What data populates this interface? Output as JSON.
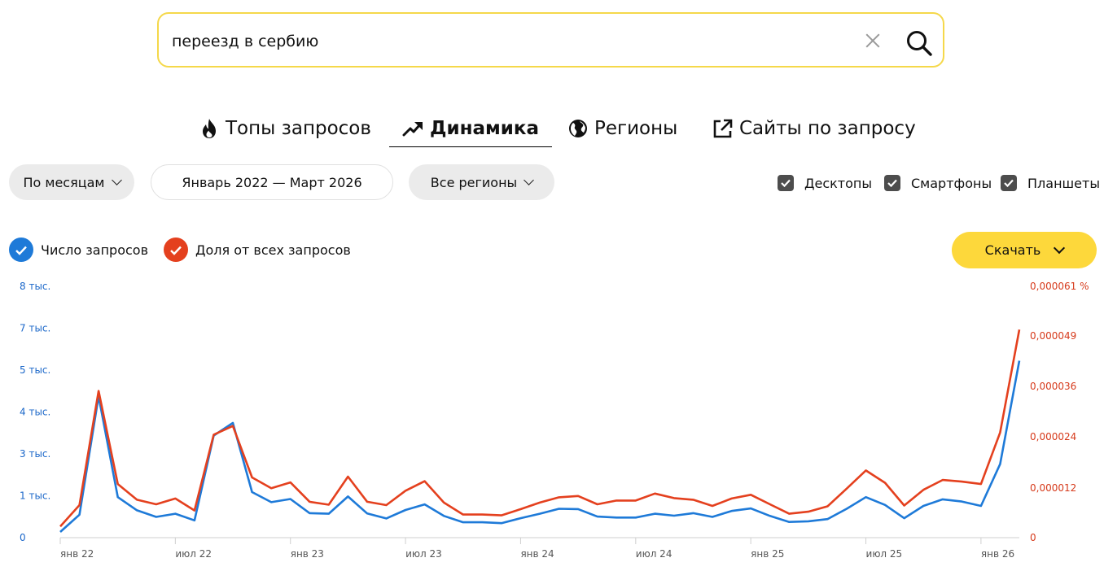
{
  "search": {
    "query": "переезд в сербию"
  },
  "tabs": [
    {
      "label": "Топы запросов",
      "icon": "fire-icon"
    },
    {
      "label": "Динамика",
      "icon": "trend-icon"
    },
    {
      "label": "Регионы",
      "icon": "globe-icon"
    },
    {
      "label": "Сайты по запросу",
      "icon": "external-link-icon"
    }
  ],
  "filters": {
    "period": "По месяцам",
    "range": "Январь 2022 — Март 2026",
    "region": "Все регионы"
  },
  "devices": [
    {
      "label": "Десктопы",
      "checked": true
    },
    {
      "label": "Смартфоны",
      "checked": true
    },
    {
      "label": "Планшеты",
      "checked": true
    }
  ],
  "legend": {
    "count": "Число запросов",
    "share": "Доля от всех запросов"
  },
  "download_label": "Скачать",
  "colors": {
    "accent": "#fdd83b",
    "count": "#1e7ad8",
    "share": "#e4401e"
  },
  "chart_data": {
    "type": "line",
    "x": [
      "янв 22",
      "фев 22",
      "мар 22",
      "апр 22",
      "май 22",
      "июн 22",
      "июл 22",
      "авг 22",
      "сен 22",
      "окт 22",
      "ноя 22",
      "дек 22",
      "янв 23",
      "фев 23",
      "мар 23",
      "апр 23",
      "май 23",
      "июн 23",
      "июл 23",
      "авг 23",
      "сен 23",
      "окт 23",
      "ноя 23",
      "дек 23",
      "янв 24",
      "фев 24",
      "мар 24",
      "апр 24",
      "май 24",
      "июн 24",
      "июл 24",
      "авг 24",
      "сен 24",
      "окт 24",
      "ноя 24",
      "дек 24",
      "янв 25",
      "фев 25",
      "мар 25",
      "апр 25",
      "май 25",
      "июн 25",
      "июл 25",
      "авг 25",
      "сен 25",
      "окт 25",
      "ноя 25",
      "дек 25",
      "янв 26",
      "фев 26",
      "мар 26"
    ],
    "x_ticks": [
      "янв 22",
      "июл 22",
      "янв 23",
      "июл 23",
      "янв 24",
      "июл 24",
      "янв 25",
      "июл 25",
      "янв 26"
    ],
    "y_left_ticks": [
      "0",
      "1 тыс.",
      "3 тыс.",
      "4 тыс.",
      "5 тыс.",
      "7 тыс.",
      "8 тыс."
    ],
    "y_right_ticks": [
      "0",
      "0,000012",
      "0,000024",
      "0,000036",
      "0,000049",
      "0,000061 %"
    ],
    "ylim_left": [
      0,
      8000
    ],
    "ylim_right": [
      0,
      6.1e-05
    ],
    "series": [
      {
        "name": "Число запросов",
        "axis": "left",
        "values": [
          180,
          730,
          4500,
          1290,
          870,
          660,
          760,
          550,
          3250,
          3650,
          1450,
          1130,
          1230,
          780,
          760,
          1310,
          770,
          610,
          880,
          1060,
          690,
          490,
          490,
          460,
          620,
          760,
          920,
          910,
          670,
          640,
          640,
          760,
          700,
          780,
          660,
          850,
          930,
          690,
          500,
          520,
          590,
          920,
          1290,
          1040,
          620,
          1010,
          1220,
          1150,
          1010,
          2340,
          5630
        ]
      },
      {
        "name": "Доля от всех запросов",
        "axis": "right",
        "values": [
          2.7e-06,
          7.9e-06,
          3.56e-05,
          1.3e-05,
          9.2e-06,
          8.1e-06,
          9.5e-06,
          6.6e-06,
          2.5e-05,
          2.71e-05,
          1.46e-05,
          1.2e-05,
          1.34e-05,
          8.7e-06,
          8e-06,
          1.48e-05,
          8.7e-06,
          7.9e-06,
          1.14e-05,
          1.37e-05,
          8.5e-06,
          5.6e-06,
          5.6e-06,
          5.4e-06,
          6.9e-06,
          8.5e-06,
          9.8e-06,
          1.01e-05,
          8.1e-06,
          9e-06,
          9e-06,
          1.07e-05,
          9.6e-06,
          9.2e-06,
          7.7e-06,
          9.5e-06,
          1.04e-05,
          8.1e-06,
          5.8e-06,
          6.3e-06,
          7.6e-06,
          1.19e-05,
          1.63e-05,
          1.33e-05,
          7.8e-06,
          1.16e-05,
          1.4e-05,
          1.36e-05,
          1.3e-05,
          2.55e-05,
          5.05e-05
        ]
      }
    ],
    "grid": false
  }
}
